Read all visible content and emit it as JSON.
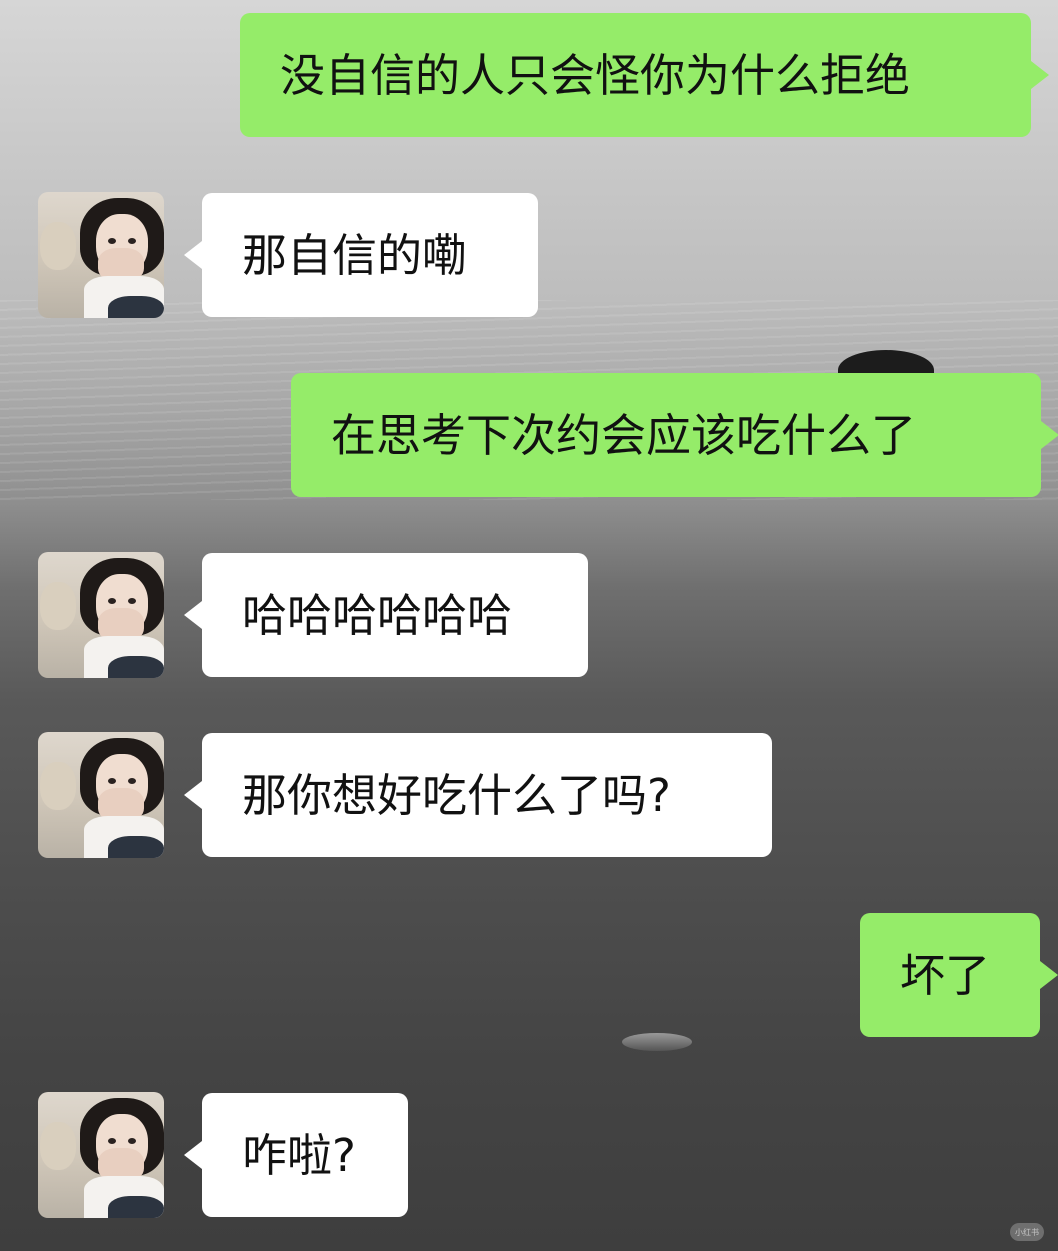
{
  "chat": {
    "messages": [
      {
        "side": "right",
        "text": "没自信的人只会怪你为什么拒绝"
      },
      {
        "side": "left",
        "text": "那自信的嘞"
      },
      {
        "side": "right",
        "text": "在思考下次约会应该吃什么了"
      },
      {
        "side": "left",
        "text": "哈哈哈哈哈哈"
      },
      {
        "side": "left",
        "text": "那你想好吃什么了吗?"
      },
      {
        "side": "right",
        "text": "坏了"
      },
      {
        "side": "left",
        "text": "咋啦?"
      }
    ],
    "colors": {
      "sent_bubble": "#95ec69",
      "received_bubble": "#ffffff",
      "text": "#111111"
    },
    "avatar_icon": "user-avatar-photo"
  },
  "watermark": {
    "text": "小红书"
  }
}
